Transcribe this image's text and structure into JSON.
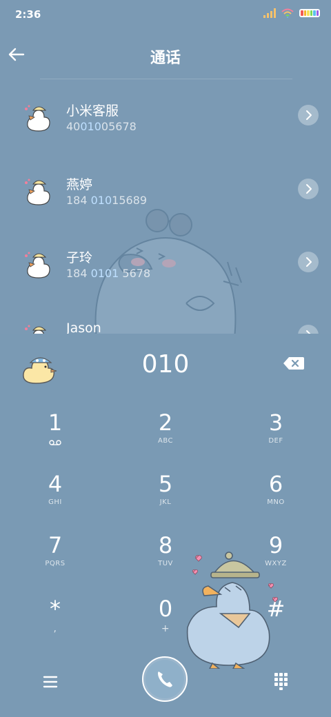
{
  "status": {
    "time": "2:36",
    "battery_colors": [
      "#f25c54",
      "#f7b32b",
      "#f7e35b",
      "#7ed957",
      "#5bc0eb",
      "#9b5de5"
    ]
  },
  "header": {
    "title": "通话"
  },
  "contacts": [
    {
      "name": "小米客服",
      "number_pre": "40",
      "number_hl": "010",
      "number_post": "05678"
    },
    {
      "name": "燕婷",
      "number_pre": "184 ",
      "number_hl": "010",
      "number_post": "15689"
    },
    {
      "name": "子玲",
      "number_pre": "184 ",
      "number_hl": "0101",
      "number_post": " 5678"
    },
    {
      "name": "Jason",
      "number_pre": "",
      "number_hl": "",
      "number_post": ""
    }
  ],
  "dialer": {
    "input": "010",
    "keys": [
      {
        "digit": "1",
        "letters": ""
      },
      {
        "digit": "2",
        "letters": "ABC"
      },
      {
        "digit": "3",
        "letters": "DEF"
      },
      {
        "digit": "4",
        "letters": "GHI"
      },
      {
        "digit": "5",
        "letters": "JKL"
      },
      {
        "digit": "6",
        "letters": "MNO"
      },
      {
        "digit": "7",
        "letters": "PQRS"
      },
      {
        "digit": "8",
        "letters": "TUV"
      },
      {
        "digit": "9",
        "letters": "WXYZ"
      },
      {
        "digit": "*",
        "letters": ","
      },
      {
        "digit": "0",
        "letters": "+"
      },
      {
        "digit": "#",
        "letters": ""
      }
    ]
  },
  "icons": {
    "back": "back-arrow-icon",
    "voicemail": "voicemail-icon",
    "backspace": "backspace-icon",
    "menu": "menu-icon",
    "call": "phone-icon",
    "keypad": "keypad-icon"
  }
}
